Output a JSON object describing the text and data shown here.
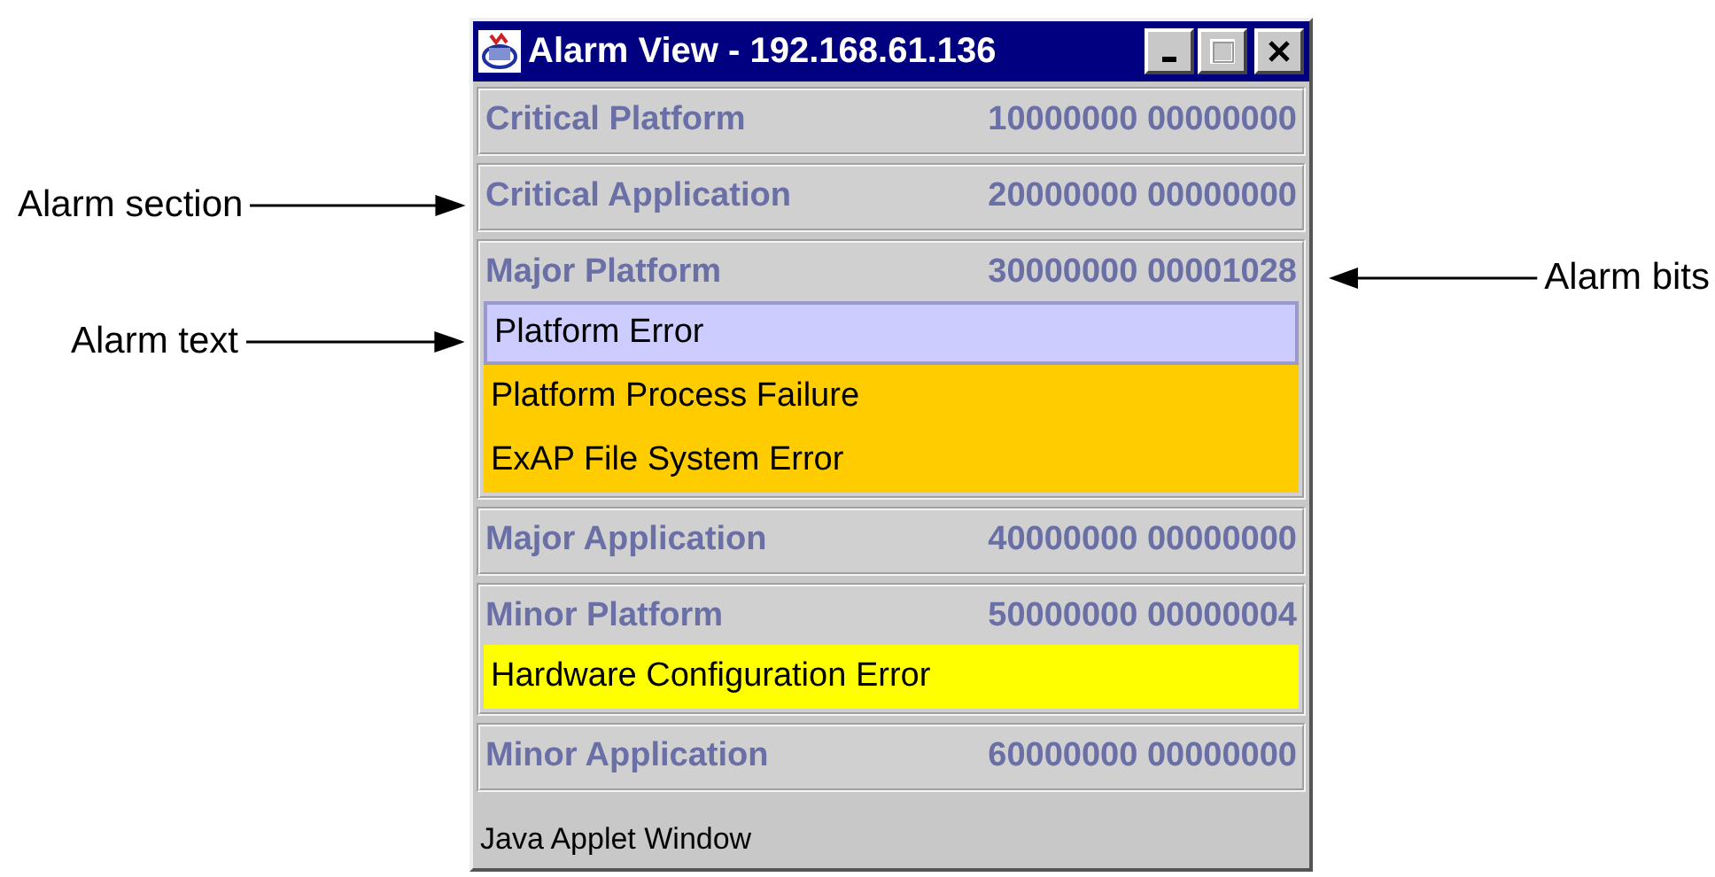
{
  "window": {
    "title": "Alarm View - 192.168.61.136"
  },
  "sections": [
    {
      "name": "Critical Platform",
      "bits": "10000000 00000000"
    },
    {
      "name": "Critical Application",
      "bits": "20000000 00000000"
    },
    {
      "name": "Major Platform",
      "bits": "30000000 00001028",
      "alarms": [
        {
          "text": "Platform Error",
          "color": "#ccccff",
          "selected": true
        },
        {
          "text": "Platform Process Failure",
          "color": "#ffcc00",
          "selected": false
        },
        {
          "text": "ExAP File System Error",
          "color": "#ffcc00",
          "selected": false
        }
      ]
    },
    {
      "name": "Major Application",
      "bits": "40000000 00000000"
    },
    {
      "name": "Minor Platform",
      "bits": "50000000 00000004",
      "alarms": [
        {
          "text": "Hardware Configuration Error",
          "color": "#ffff00",
          "selected": false
        }
      ]
    },
    {
      "name": "Minor Application",
      "bits": "60000000 00000000"
    }
  ],
  "status_bar": "Java Applet Window",
  "callouts": [
    {
      "text": "Alarm section"
    },
    {
      "text": "Alarm text"
    },
    {
      "text": "Alarm bits"
    }
  ]
}
